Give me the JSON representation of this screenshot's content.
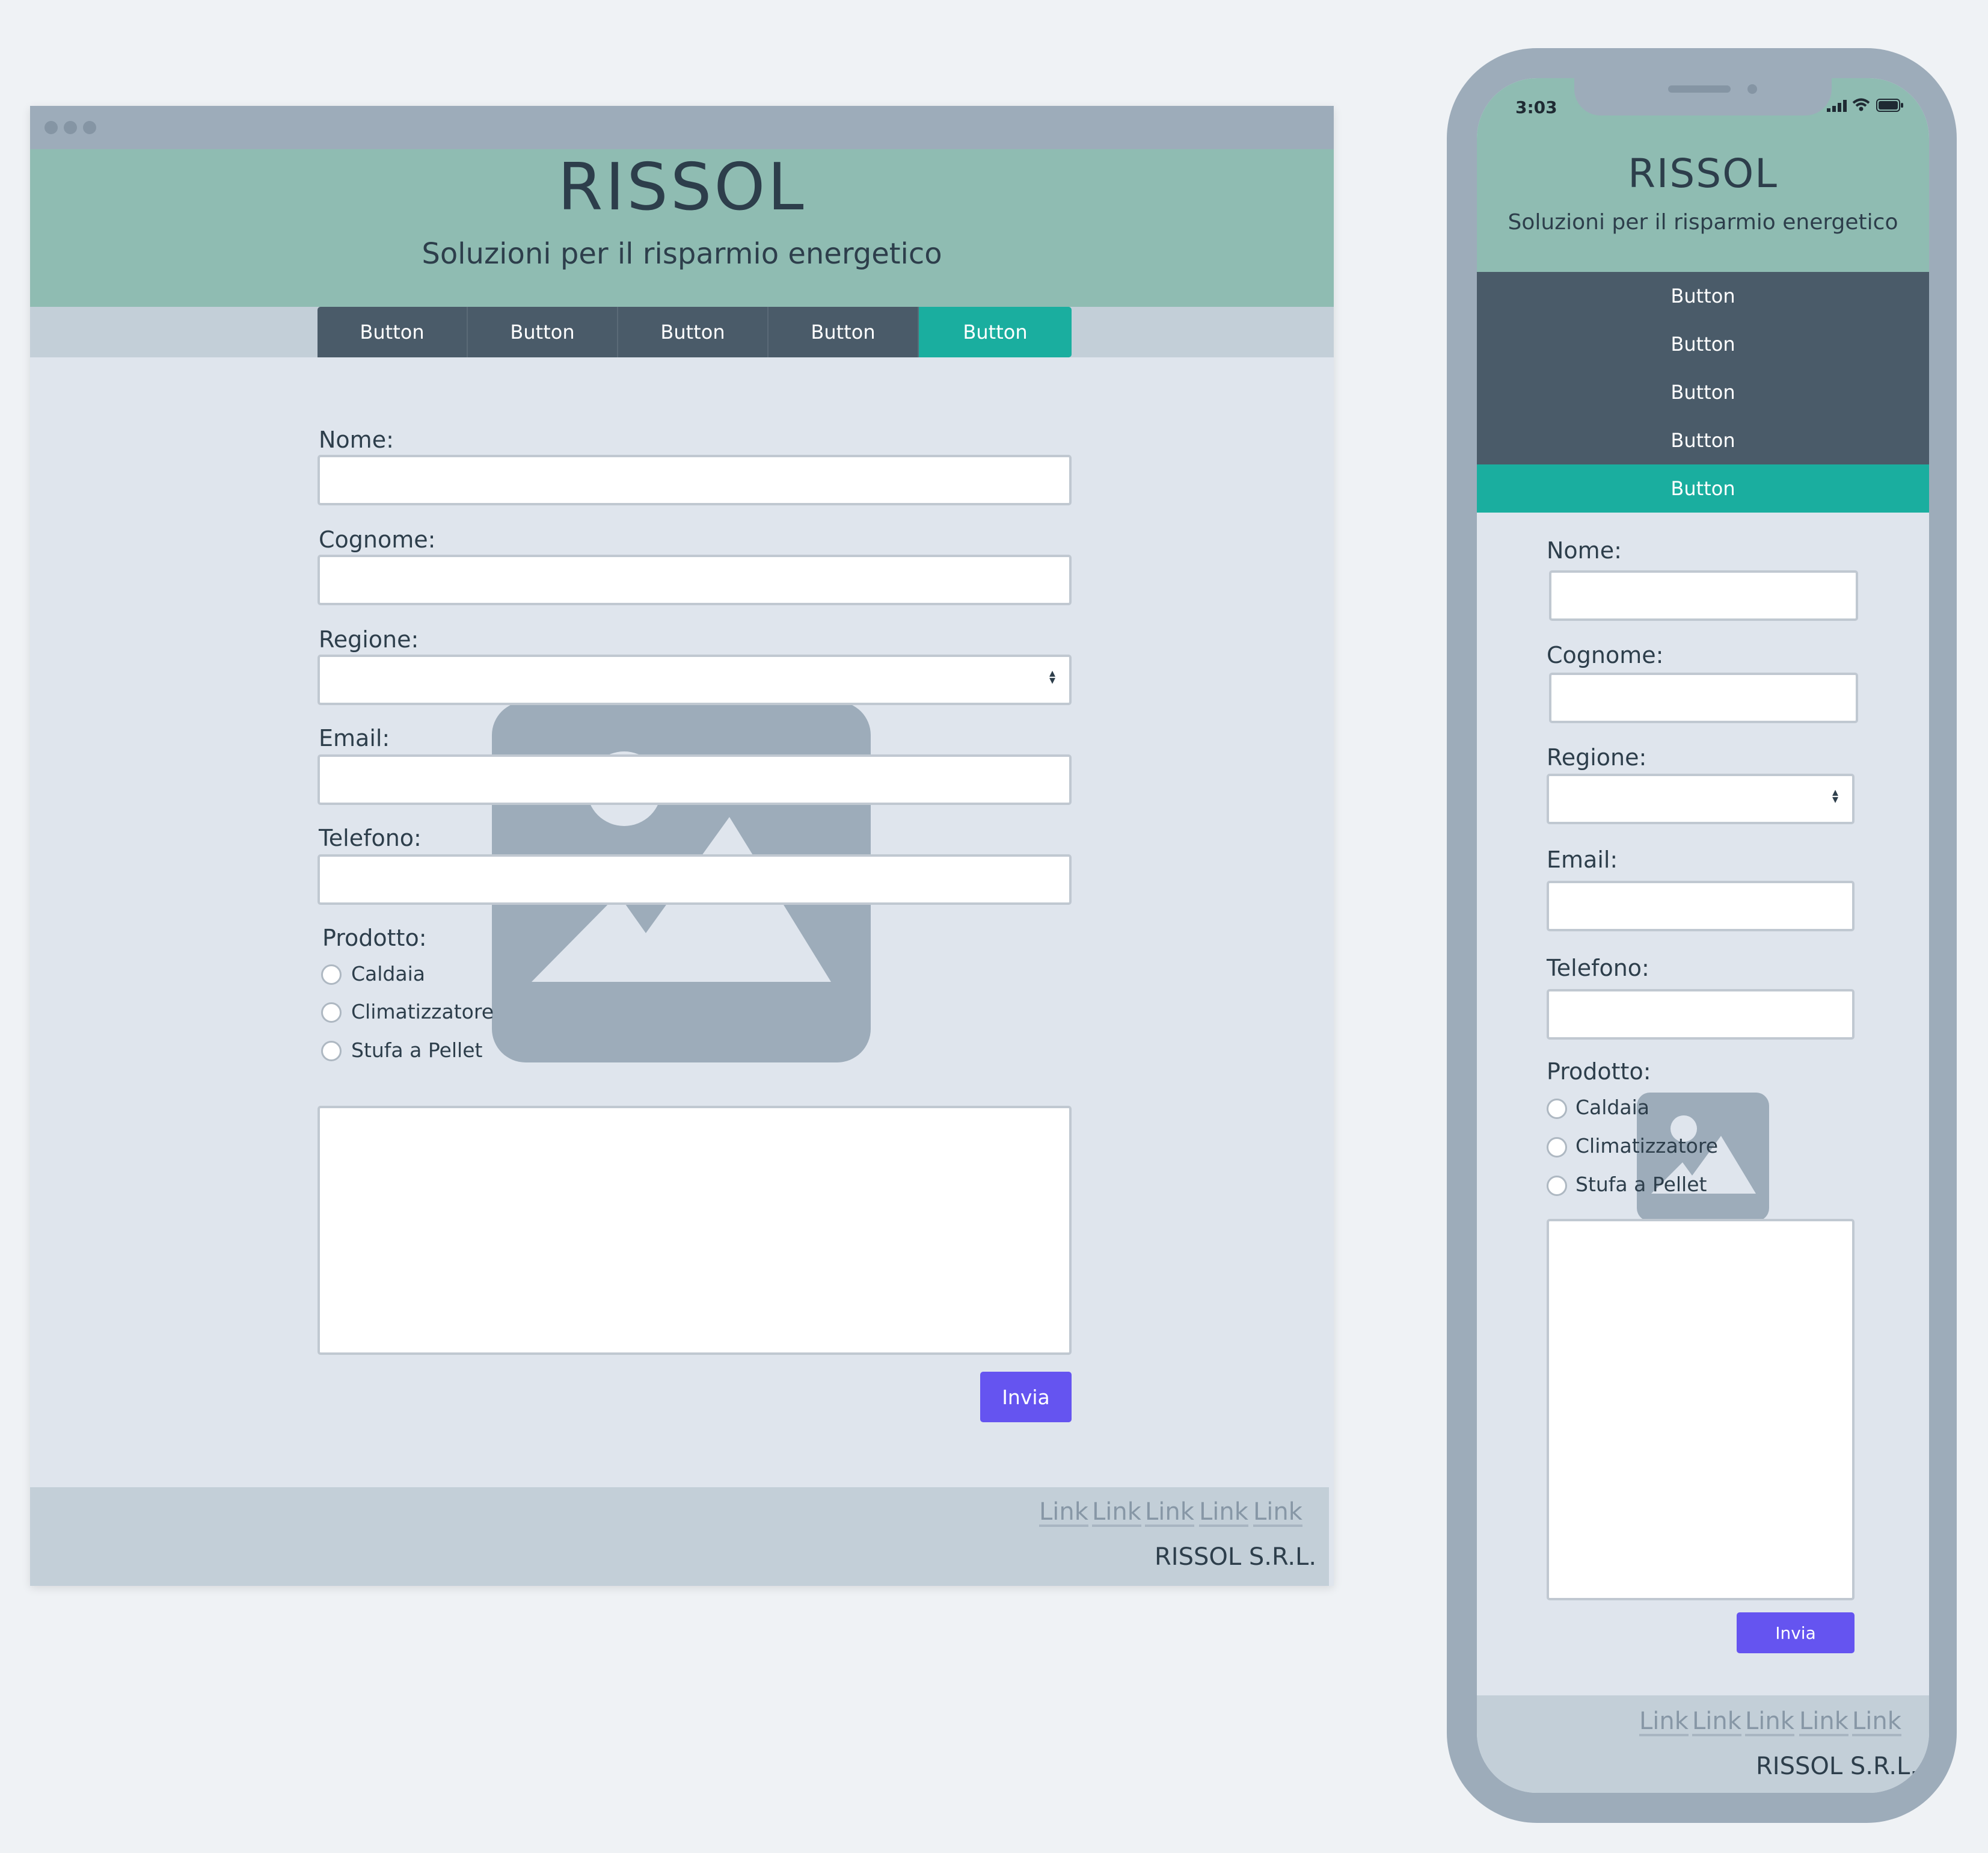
{
  "desktop": {
    "header": {
      "title": "RISSOL",
      "subtitle": "Soluzioni per il risparmio energetico"
    },
    "nav": [
      "Button",
      "Button",
      "Button",
      "Button",
      "Button"
    ],
    "form": {
      "nome_label": "Nome:",
      "cognome_label": "Cognome:",
      "regione_label": "Regione:",
      "email_label": "Email:",
      "telefono_label": "Telefono:",
      "prodotto_label": "Prodotto:",
      "options": [
        "Caldaia",
        "Climatizzatore",
        "Stufa a Pellet"
      ],
      "submit": "Invia"
    },
    "footer": {
      "links": [
        "Link",
        "Link",
        "Link",
        "Link",
        "Link"
      ],
      "copyright": "RISSOL S.R.L."
    }
  },
  "mobile": {
    "status": {
      "time": "3:03"
    },
    "header": {
      "title": "RISSOL",
      "subtitle": "Soluzioni per il risparmio energetico"
    },
    "nav": [
      "Button",
      "Button",
      "Button",
      "Button",
      "Button"
    ],
    "form": {
      "nome_label": "Nome:",
      "cognome_label": "Cognome:",
      "regione_label": "Regione:",
      "email_label": "Email:",
      "telefono_label": "Telefono:",
      "prodotto_label": "Prodotto:",
      "options": [
        "Caldaia",
        "Climatizzatore",
        "Stufa a Pellet"
      ],
      "submit": "Invia"
    },
    "footer": {
      "links": [
        "Link",
        "Link",
        "Link",
        "Link",
        "Link"
      ],
      "copyright": "RISSOL S.R.L."
    }
  },
  "icons": {
    "image_placeholder": "image-placeholder-icon",
    "signal": "signal-icon",
    "wifi": "wifi-icon",
    "battery": "battery-icon",
    "select_arrow": "select-arrow-icon"
  },
  "colors": {
    "header": "#8fbcb2",
    "nav": "#4a5b69",
    "nav_active": "#1aae9f",
    "submit": "#6554f0",
    "frame": "#9dacba",
    "footer": "#c3cfd8"
  }
}
